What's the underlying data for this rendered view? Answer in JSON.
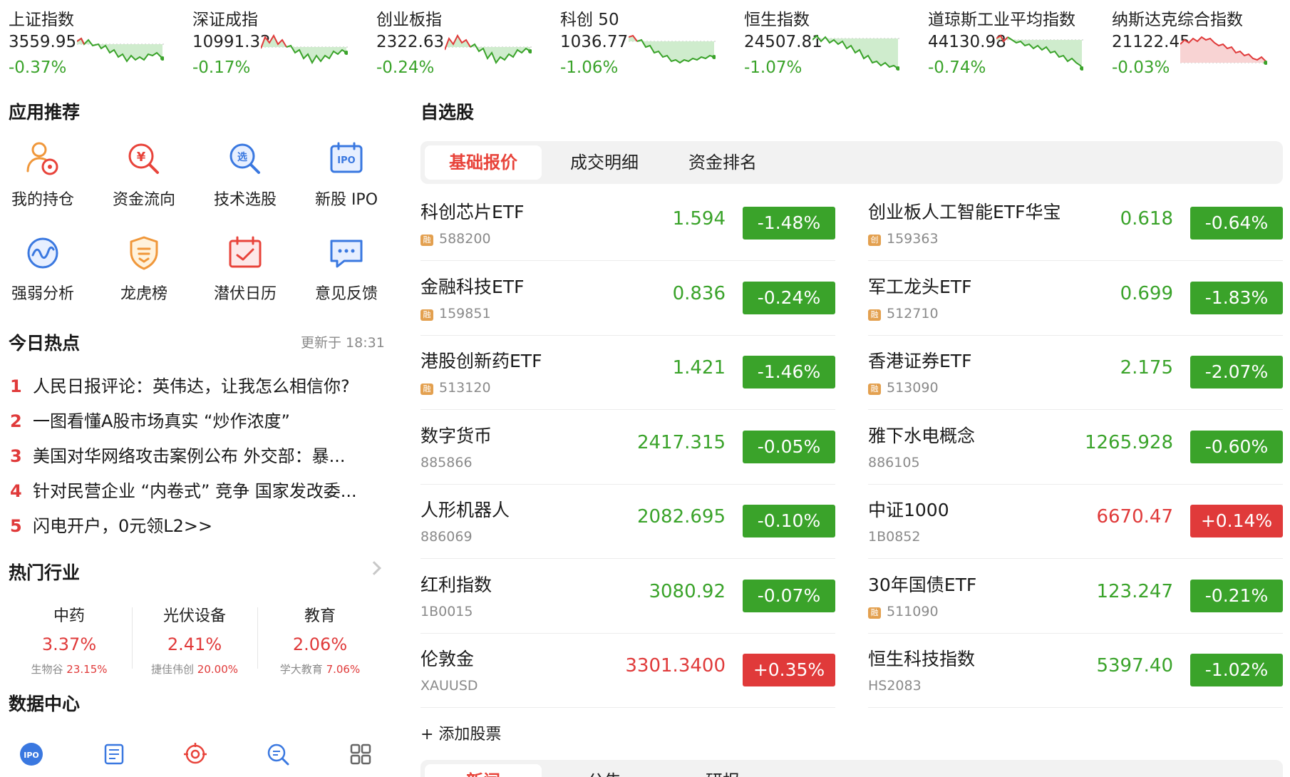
{
  "indices": [
    {
      "name": "上证指数",
      "price": "3559.95",
      "change": "-0.37%",
      "trend": "down"
    },
    {
      "name": "深证成指",
      "price": "10991.32",
      "change": "-0.17%",
      "trend": "down"
    },
    {
      "name": "创业板指",
      "price": "2322.63",
      "change": "-0.24%",
      "trend": "down"
    },
    {
      "name": "科创 50",
      "price": "1036.77",
      "change": "-1.06%",
      "trend": "down"
    },
    {
      "name": "恒生指数",
      "price": "24507.81",
      "change": "-1.07%",
      "trend": "down"
    },
    {
      "name": "道琼斯工业平均指数",
      "price": "44130.98",
      "change": "-0.74%",
      "trend": "down"
    },
    {
      "name": "纳斯达克综合指数",
      "price": "21122.45",
      "change": "-0.03%",
      "trend": "down"
    }
  ],
  "apps": {
    "title": "应用推荐",
    "items": [
      {
        "label": "我的持仓",
        "icon": "person-coin-icon"
      },
      {
        "label": "资金流向",
        "icon": "yuan-search-icon"
      },
      {
        "label": "技术选股",
        "icon": "select-search-icon"
      },
      {
        "label": "新股 IPO",
        "icon": "ipo-calendar-icon"
      },
      {
        "label": "强弱分析",
        "icon": "wave-circle-icon"
      },
      {
        "label": "龙虎榜",
        "icon": "shield-icon"
      },
      {
        "label": "潜伏日历",
        "icon": "calendar-check-icon"
      },
      {
        "label": "意见反馈",
        "icon": "chat-bubble-icon"
      }
    ]
  },
  "hot_today": {
    "title": "今日热点",
    "updated": "更新于 18:31",
    "items": [
      {
        "rank": "1",
        "text": "人民日报评论：英伟达，让我怎么相信你?"
      },
      {
        "rank": "2",
        "text": "一图看懂A股市场真实 “炒作浓度”"
      },
      {
        "rank": "3",
        "text": "美国对华网络攻击案例公布 外交部：暴..."
      },
      {
        "rank": "4",
        "text": "针对民营企业 “内卷式” 竞争 国家发改委..."
      },
      {
        "rank": "5",
        "text": "闪电开户，0元领L2>>"
      }
    ]
  },
  "industries": {
    "title": "热门行业",
    "items": [
      {
        "name": "中药",
        "pct": "3.37%",
        "leader": "生物谷",
        "leader_pct": "23.15%"
      },
      {
        "name": "光伏设备",
        "pct": "2.41%",
        "leader": "捷佳伟创",
        "leader_pct": "20.00%"
      },
      {
        "name": "教育",
        "pct": "2.06%",
        "leader": "学大教育",
        "leader_pct": "7.06%"
      }
    ]
  },
  "data_center": {
    "title": "数据中心",
    "icons": [
      "ipo-badge-icon",
      "report-icon",
      "target-icon",
      "search-list-icon",
      "grid-icon"
    ],
    "ipo_text": "IPO"
  },
  "watchlist": {
    "title": "自选股",
    "tabs": [
      "基础报价",
      "成交明细",
      "资金排名"
    ],
    "active_tab": 0,
    "rows": [
      {
        "name": "科创芯片ETF",
        "tag": "融",
        "code": "588200",
        "price": "1.594",
        "change": "-1.48%",
        "dir": "down"
      },
      {
        "name": "创业板人工智能ETF华宝",
        "tag": "创",
        "code": "159363",
        "price": "0.618",
        "change": "-0.64%",
        "dir": "down"
      },
      {
        "name": "金融科技ETF",
        "tag": "融",
        "code": "159851",
        "price": "0.836",
        "change": "-0.24%",
        "dir": "down"
      },
      {
        "name": "军工龙头ETF",
        "tag": "融",
        "code": "512710",
        "price": "0.699",
        "change": "-1.83%",
        "dir": "down"
      },
      {
        "name": "港股创新药ETF",
        "tag": "融",
        "code": "513120",
        "price": "1.421",
        "change": "-1.46%",
        "dir": "down"
      },
      {
        "name": "香港证券ETF",
        "tag": "融",
        "code": "513090",
        "price": "2.175",
        "change": "-2.07%",
        "dir": "down"
      },
      {
        "name": "数字货币",
        "tag": "",
        "code": "885866",
        "price": "2417.315",
        "change": "-0.05%",
        "dir": "down"
      },
      {
        "name": "雅下水电概念",
        "tag": "",
        "code": "886105",
        "price": "1265.928",
        "change": "-0.60%",
        "dir": "down"
      },
      {
        "name": "人形机器人",
        "tag": "",
        "code": "886069",
        "price": "2082.695",
        "change": "-0.10%",
        "dir": "down"
      },
      {
        "name": "中证1000",
        "tag": "",
        "code": "1B0852",
        "price": "6670.47",
        "change": "+0.14%",
        "dir": "up"
      },
      {
        "name": "红利指数",
        "tag": "",
        "code": "1B0015",
        "price": "3080.92",
        "change": "-0.07%",
        "dir": "down"
      },
      {
        "name": "30年国债ETF",
        "tag": "融",
        "code": "511090",
        "price": "123.247",
        "change": "-0.21%",
        "dir": "down"
      },
      {
        "name": "伦敦金",
        "tag": "",
        "code": "XAUUSD",
        "price": "3301.3400",
        "change": "+0.35%",
        "dir": "up"
      },
      {
        "name": "恒生科技指数",
        "tag": "",
        "code": "HS2083",
        "price": "5397.40",
        "change": "-1.02%",
        "dir": "down"
      }
    ],
    "add_label": "+ 添加股票"
  },
  "news_tabs": [
    "新闻",
    "公告",
    "研报"
  ],
  "colors": {
    "up": "#e03a3a",
    "down": "#3aa32a",
    "accent": "#e8433a"
  }
}
